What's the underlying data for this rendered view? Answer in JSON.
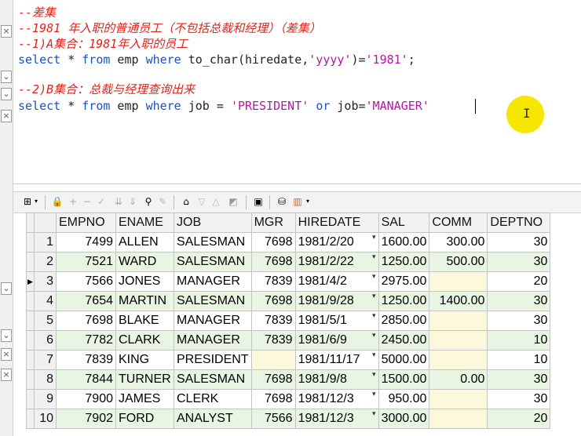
{
  "editor": {
    "lines": [
      "--差集",
      "--1981 年入职的普通员工（不包括总裁和经理）（差集）",
      "--1)A集合：1981年入职的员工",
      "",
      "",
      "--2)B集合：总裁与经理查询出来",
      ""
    ],
    "q1": {
      "kw1": "select",
      "t1": " * ",
      "kw2": "from",
      "t2": " emp ",
      "kw3": "where",
      "t3": " to_char(hiredate,",
      "s1": "'yyyy'",
      "t4": ")=",
      "s2": "'1981'",
      "t5": ";"
    },
    "q2": {
      "kw1": "select",
      "t1": " * ",
      "kw2": "from",
      "t2": " emp ",
      "kw3": "where",
      "t3": " job = ",
      "s1": "'PRESIDENT'",
      "t4": " ",
      "kw4": "or",
      "t5": " job=",
      "s2": "'MANAGER'"
    },
    "cursor_glyph": "I"
  },
  "grid": {
    "columns": [
      "EMPNO",
      "ENAME",
      "JOB",
      "MGR",
      "HIREDATE",
      "SAL",
      "COMM",
      "DEPTNO"
    ],
    "current_row": 3,
    "rows": [
      {
        "n": "1",
        "empno": "7499",
        "ename": "ALLEN",
        "job": "SALESMAN",
        "mgr": "7698",
        "hiredate": "1981/2/20",
        "sal": "1600.00",
        "comm": "300.00",
        "deptno": "30"
      },
      {
        "n": "2",
        "empno": "7521",
        "ename": "WARD",
        "job": "SALESMAN",
        "mgr": "7698",
        "hiredate": "1981/2/22",
        "sal": "1250.00",
        "comm": "500.00",
        "deptno": "30"
      },
      {
        "n": "3",
        "empno": "7566",
        "ename": "JONES",
        "job": "MANAGER",
        "mgr": "7839",
        "hiredate": "1981/4/2",
        "sal": "2975.00",
        "comm": "",
        "deptno": "20"
      },
      {
        "n": "4",
        "empno": "7654",
        "ename": "MARTIN",
        "job": "SALESMAN",
        "mgr": "7698",
        "hiredate": "1981/9/28",
        "sal": "1250.00",
        "comm": "1400.00",
        "deptno": "30"
      },
      {
        "n": "5",
        "empno": "7698",
        "ename": "BLAKE",
        "job": "MANAGER",
        "mgr": "7839",
        "hiredate": "1981/5/1",
        "sal": "2850.00",
        "comm": "",
        "deptno": "30"
      },
      {
        "n": "6",
        "empno": "7782",
        "ename": "CLARK",
        "job": "MANAGER",
        "mgr": "7839",
        "hiredate": "1981/6/9",
        "sal": "2450.00",
        "comm": "",
        "deptno": "10"
      },
      {
        "n": "7",
        "empno": "7839",
        "ename": "KING",
        "job": "PRESIDENT",
        "mgr": "",
        "hiredate": "1981/11/17",
        "sal": "5000.00",
        "comm": "",
        "deptno": "10"
      },
      {
        "n": "8",
        "empno": "7844",
        "ename": "TURNER",
        "job": "SALESMAN",
        "mgr": "7698",
        "hiredate": "1981/9/8",
        "sal": "1500.00",
        "comm": "0.00",
        "deptno": "30"
      },
      {
        "n": "9",
        "empno": "7900",
        "ename": "JAMES",
        "job": "CLERK",
        "mgr": "7698",
        "hiredate": "1981/12/3",
        "sal": "950.00",
        "comm": "",
        "deptno": "30"
      },
      {
        "n": "10",
        "empno": "7902",
        "ename": "FORD",
        "job": "ANALYST",
        "mgr": "7566",
        "hiredate": "1981/12/3",
        "sal": "3000.00",
        "comm": "",
        "deptno": "20"
      }
    ]
  },
  "toolbar": {
    "icons": [
      "grid-select-icon",
      "lock-icon",
      "add-record-icon",
      "delete-record-icon",
      "post-changes-icon",
      "fetch-next-icon",
      "fetch-all-icon",
      "find-icon",
      "clear-icon",
      "query-by-example-icon",
      "filter-icon",
      "previous-icon",
      "single-record-icon",
      "save-icon",
      "export-icon",
      "chart-icon"
    ]
  },
  "colors": {
    "comment": "#e2231a",
    "keyword": "#1a4fcc",
    "string": "#b5179e",
    "alt_row": "#e7f5e2",
    "null_cell": "#fbf8dc",
    "cursor_highlight": "#f6e600"
  }
}
